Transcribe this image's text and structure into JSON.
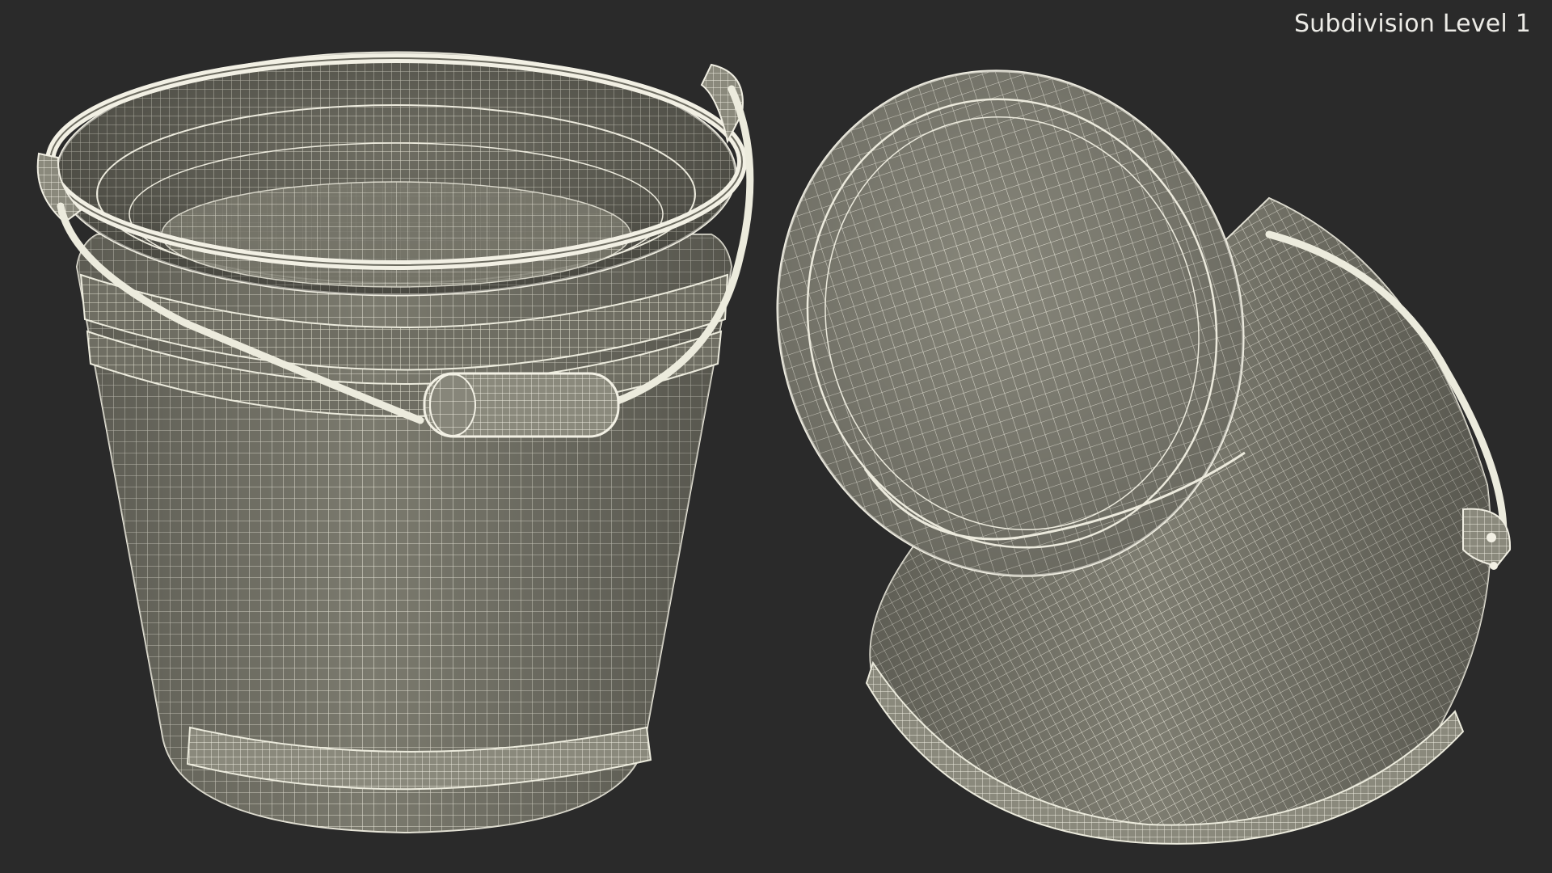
{
  "viewport": {
    "label": "Subdivision Level 1",
    "background_color": "#2a2a2a",
    "mesh_fill_color": "#7d7c70",
    "wire_color": "#e9e7da"
  },
  "objects": [
    {
      "name": "bucket-upright"
    },
    {
      "name": "bucket-tilted"
    }
  ]
}
